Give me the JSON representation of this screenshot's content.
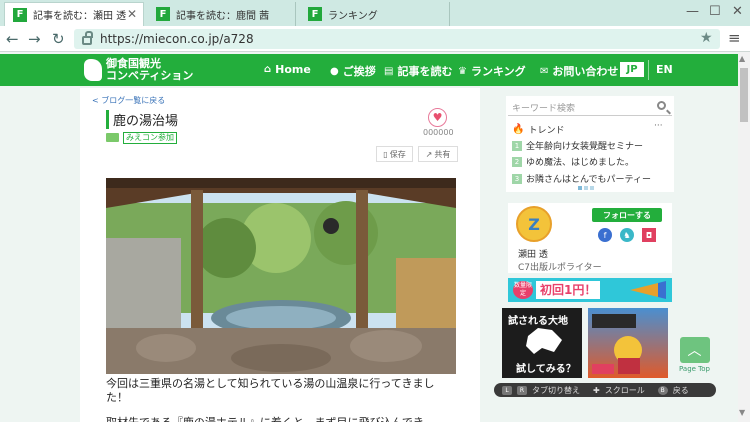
{
  "tabs": [
    {
      "label": "記事を読む：瀬田 透",
      "active": true
    },
    {
      "label": "記事を読む：鹿間 茜",
      "active": false
    },
    {
      "label": "ランキング",
      "active": false
    }
  ],
  "address": {
    "url": "https://miecon.co.jp/a728"
  },
  "header": {
    "logo_line1": "御食国観光",
    "logo_line2": "コンベティション",
    "nav": [
      "Home",
      "ご挨拶",
      "記事を読む",
      "ランキング",
      "お問い合わせ"
    ],
    "lang_jp": "JP",
    "lang_en": "EN"
  },
  "article": {
    "back": "ブログ一覧に戻る",
    "title": "鹿の湯治場",
    "category": "みえコン参加",
    "likes": "000000",
    "save": "保存",
    "share": "共有",
    "body1": "今回は三重県の名湯として知られている湯の山温泉に行ってきました！",
    "body2": "取材先である『鹿の湯ホテル』に着くと、まず目に飛び込んでき"
  },
  "sidebar": {
    "search_placeholder": "キーワード検索",
    "trend_title": "トレンド",
    "trends": [
      {
        "num": "1",
        "text": "全年齢向け女装覺醒セミナー"
      },
      {
        "num": "2",
        "text": "ゆめ魔法、はじめました。"
      },
      {
        "num": "3",
        "text": "お隣さんはとんでもパーティー"
      }
    ],
    "follow": "フォローする",
    "author_name": "瀬田 透",
    "author_role": "C7出版ルポライター",
    "banner_tag": "数量限定",
    "banner_text": "初回1円！",
    "ad1_line1": "試される大地",
    "ad1_line2": "試してみる？",
    "pagetop_label": "Page Top",
    "control_tab": "タブ切り替え",
    "control_scroll": "スクロール",
    "control_back": "戻る",
    "key_l": "L",
    "key_r": "R",
    "key_b": "B"
  },
  "colors": {
    "brand_green": "#23ae3c",
    "tab_bg": "#cfe9e3"
  }
}
